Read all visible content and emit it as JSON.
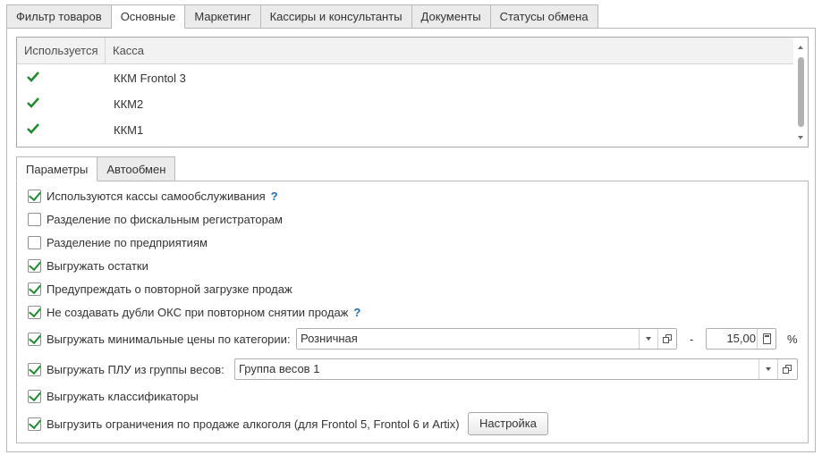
{
  "top_tabs": [
    "Фильтр товаров",
    "Основные",
    "Маркетинг",
    "Кассиры и консультанты",
    "Документы",
    "Статусы обмена"
  ],
  "table": {
    "headers": {
      "used": "Используется",
      "kassa": "Касса"
    },
    "rows": [
      {
        "used": true,
        "name": "ККМ Frontol 3"
      },
      {
        "used": true,
        "name": "ККМ2"
      },
      {
        "used": true,
        "name": "ККМ1"
      }
    ]
  },
  "inner_tabs": [
    "Параметры",
    "Автообмен"
  ],
  "options": [
    {
      "label": "Используются кассы самообслуживания",
      "checked": true,
      "help": "?"
    },
    {
      "label": "Разделение по фискальным регистраторам",
      "checked": false
    },
    {
      "label": "Разделение по предприятиям",
      "checked": false
    },
    {
      "label": "Выгружать остатки",
      "checked": true
    },
    {
      "label": "Предупреждать о повторной загрузке продаж",
      "checked": true
    },
    {
      "label": "Не создавать дубли ОКС при повторном снятии продаж",
      "checked": true,
      "help": "?"
    },
    {
      "label": "Выгружать минимальные цены по категории:",
      "checked": true
    },
    {
      "label": "Выгружать ПЛУ из группы весов:",
      "checked": true
    },
    {
      "label": "Выгружать классификаторы",
      "checked": true
    },
    {
      "label": "Выгрузить ограничения по продаже алкоголя (для Frontol 5, Frontol 6 и Artix)",
      "checked": true
    }
  ],
  "min_price": {
    "category": "Розничная",
    "dash": "-",
    "value": "15,00",
    "unit": "%"
  },
  "plu": {
    "group": "Группа весов 1"
  },
  "settings_button": "Настройка",
  "colors": {
    "check_green": "#1d8c2d",
    "help_blue": "#1a6eb8"
  }
}
